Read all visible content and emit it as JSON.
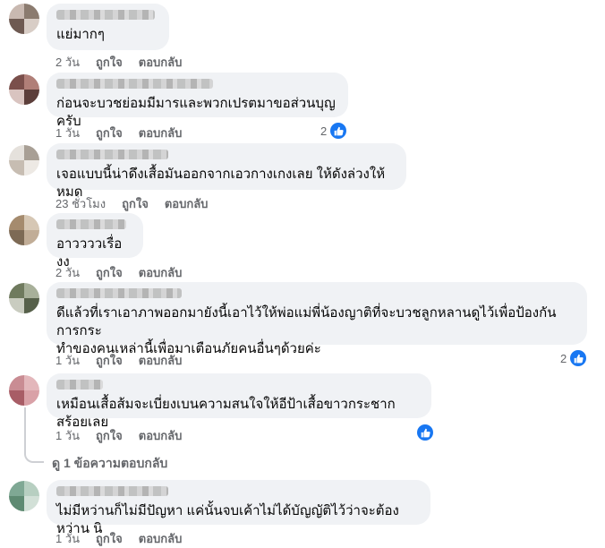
{
  "comments": [
    {
      "text": "แย่มากๆ",
      "time": "2 วัน",
      "like": "ถูกใจ",
      "reply": "ตอบกลับ",
      "reactions": ""
    },
    {
      "text": "ก่อนจะบวชย่อมมีมารและพวกเปรตมาขอส่วนบุญครับ",
      "time": "1 วัน",
      "like": "ถูกใจ",
      "reply": "ตอบกลับ",
      "reactions": "2"
    },
    {
      "text": "เจอแบบนี้น่าดึงเสื้อมันออกจากเอวกางเกงเลย ให้ดังล่วงให้หมด",
      "time": "23 ชั่วโมง",
      "like": "ถูกใจ",
      "reply": "ตอบกลับ",
      "reactions": ""
    },
    {
      "text": "อาววววเรื่องง",
      "time": "2 วัน",
      "like": "ถูกใจ",
      "reply": "ตอบกลับ",
      "reactions": ""
    },
    {
      "text": "ดีแล้วที่เราเอาภาพออกมายังนี้เอาไว้ให้พ่อแม่พี่น้องญาติที่จะบวชลูกหลานดูไว้เพื่อป้องกันการกระ\nทำของคนเหล่านี้เพื่อมาเตือนภัยคนอื่นๆด้วยค่ะ",
      "time": "1 วัน",
      "like": "ถูกใจ",
      "reply": "ตอบกลับ",
      "reactions": "2"
    },
    {
      "text": "เหมือนเสื้อส้มจะเบี่ยงเบนความสนใจให้อีป้าเสื้อขาวกระชากสร้อยเลย",
      "time": "1 วัน",
      "like": "ถูกใจ",
      "reply": "ตอบกลับ",
      "reactions": ""
    },
    {
      "text": "ไม่มีหว่านก็ไม่มีปัญหา แค่นั้นจบเค้าไม่ได้บัญญัติไว้ว่าจะต้องหว่าน นิ",
      "time": "1 วัน",
      "like": "ถูกใจ",
      "reply": "ตอบกลับ",
      "reactions": ""
    }
  ],
  "view_replies": "ดู 1 ข้อความตอบกลับ",
  "colors": {
    "like_blue": "#1877f2",
    "bubble": "#f0f2f5",
    "meta": "#65676b"
  },
  "icons": {
    "like": "thumbs-up-icon",
    "reply_arrow": "reply-arrow-icon"
  }
}
